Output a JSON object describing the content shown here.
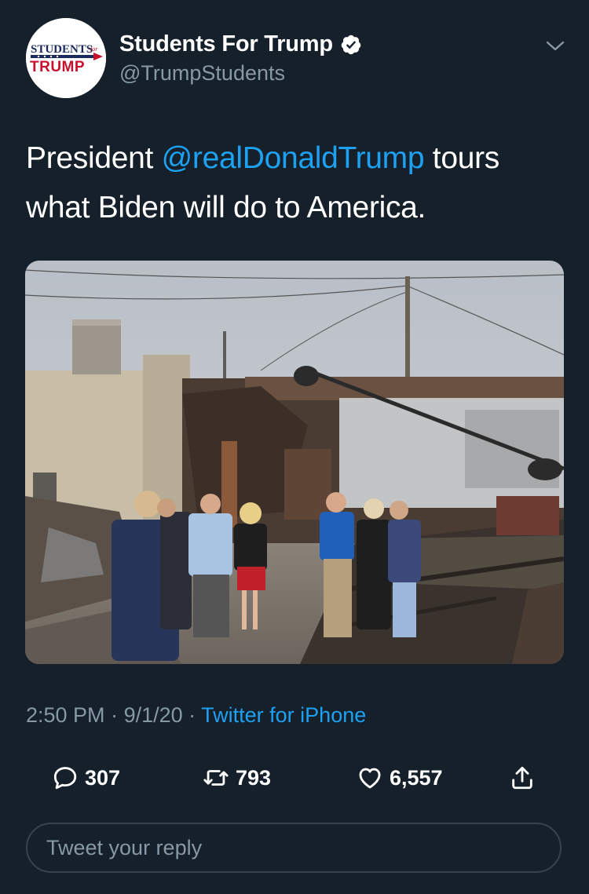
{
  "account": {
    "avatar_text_top": "STUDENTS",
    "avatar_text_for": "for",
    "avatar_text_bottom": "TRUMP",
    "display_name": "Students For Trump",
    "handle": "@TrumpStudents",
    "verified_icon": "verified-badge-icon",
    "menu_icon": "chevron-down-icon"
  },
  "tweet": {
    "text_before": "President ",
    "mention": "@realDonaldTrump",
    "text_after": " tours what Biden will do to America.",
    "media_icon": "photo"
  },
  "meta": {
    "time": "2:50 PM",
    "sep1": " · ",
    "date": "9/1/20",
    "sep2": " · ",
    "source": "Twitter for iPhone"
  },
  "actions": {
    "replies": "307",
    "retweets": "793",
    "likes": "6,557",
    "reply_icon": "reply-icon",
    "retweet_icon": "retweet-icon",
    "like_icon": "heart-icon",
    "share_icon": "share-icon"
  },
  "reply_box": {
    "placeholder": "Tweet your reply"
  },
  "colors": {
    "background": "#15202b",
    "accent": "#1da1f2",
    "secondary_text": "#8899a6",
    "border": "#38444d"
  }
}
